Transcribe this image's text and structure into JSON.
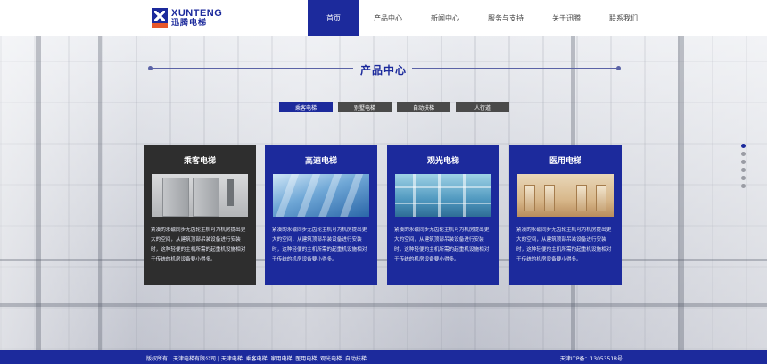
{
  "logo": {
    "en": "XUNTENG",
    "cn": "迅腾电梯"
  },
  "nav": {
    "items": [
      {
        "label": "首页"
      },
      {
        "label": "产品中心"
      },
      {
        "label": "新闻中心"
      },
      {
        "label": "服务与支持"
      },
      {
        "label": "关于迅腾"
      },
      {
        "label": "联系我们"
      }
    ]
  },
  "section": {
    "title": "产品中心"
  },
  "tabs": [
    {
      "label": "乘客电梯"
    },
    {
      "label": "别墅电梯"
    },
    {
      "label": "自动扶梯"
    },
    {
      "label": "人行道"
    }
  ],
  "cards": [
    {
      "title": "乘客电梯",
      "desc": "紧凑的永磁同步无齿轮主机可为机房提出更大的空间，从建筑顶部吊装设备进行安装时，这种轻便的主机所需的起重机设施相对于传统的机房设备要小得多。"
    },
    {
      "title": "高速电梯",
      "desc": "紧凑的永磁同步无齿轮主机可为机房提出更大的空间，从建筑顶部吊装设备进行安装时，这种轻便的主机所需的起重机设施相对于传统的机房设备要小得多。"
    },
    {
      "title": "观光电梯",
      "desc": "紧凑的永磁同步无齿轮主机可为机房提出更大的空间，从建筑顶部吊装设备进行安装时，这种轻便的主机所需的起重机设施相对于传统的机房设备要小得多。"
    },
    {
      "title": "医用电梯",
      "desc": "紧凑的永磁同步无齿轮主机可为机房提出更大的空间，从建筑顶部吊装设备进行安装时，这种轻便的主机所需的起重机设施相对于传统的机房设备要小得多。"
    }
  ],
  "footer": {
    "copyright": "版权所有：天津电梯有限公司 | 天津电梯, 乘客电梯, 家用电梯, 医用电梯, 观光电梯, 自动扶梯",
    "icp": "天津ICP备：13053518号"
  },
  "colors": {
    "primary": "#1c2a9c",
    "dark_card": "#2e2e2e",
    "accent": "#e7572a"
  }
}
